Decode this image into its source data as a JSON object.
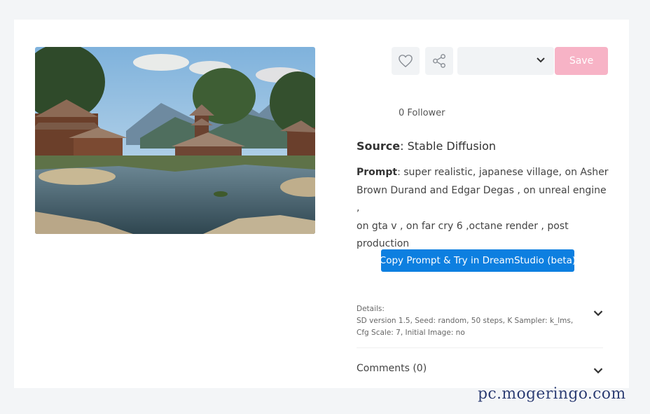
{
  "toolbar": {
    "like_icon": "heart-icon",
    "share_icon": "share-icon",
    "select_value": "",
    "save_label": "Save",
    "save_color": "#f7b3c6"
  },
  "followers": "0 Follower",
  "source": {
    "label": "Source",
    "value": ": Stable Diffusion"
  },
  "prompt": {
    "label": "Prompt",
    "line1": ": super realistic, japanese village, on Asher",
    "line2": "Brown Durand and Edgar Degas , on unreal engine ,",
    "line3": "on gta v , on far cry 6 ,octane render , post",
    "line4": "production"
  },
  "copy_button": {
    "label": "Copy Prompt & Try in DreamStudio (beta)",
    "color": "#0d7fe0"
  },
  "details": {
    "heading": "Details:",
    "line1": "SD version 1.5, Seed: random, 50 steps, K Sampler: k_lms,",
    "line2": "Cfg Scale: 7, Initial Image: no"
  },
  "comments": {
    "label": "Comments (0)"
  },
  "watermark": "pc.mogeringo.com"
}
